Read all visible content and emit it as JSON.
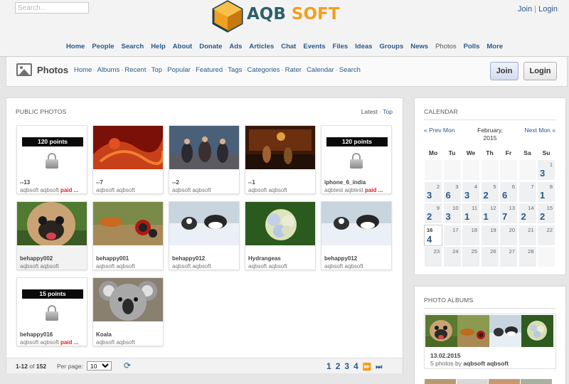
{
  "header": {
    "search_placeholder": "Search...",
    "logo": {
      "part1": "AQB",
      "part2": "SOFT"
    },
    "join_link": "Join",
    "separator": "|",
    "login_link": "Login"
  },
  "nav": [
    "Home",
    "People",
    "Search",
    "Help",
    "About",
    "Donate",
    "Ads",
    "Articles",
    "Chat",
    "Events",
    "Files",
    "Ideas",
    "Groups",
    "News",
    "Photos",
    "Polls",
    "More"
  ],
  "nav_current": "Photos",
  "section": {
    "title": "Photos",
    "subnav": [
      "Home",
      "Albums",
      "Recent",
      "Top",
      "Popular",
      "Featured",
      "Tags",
      "Categories",
      "Rater",
      "Calendar",
      "Search"
    ],
    "subnav_sep": "·",
    "join_button": "Join",
    "login_button": "Login"
  },
  "photos_panel": {
    "title": "PUBLIC PHOTOS",
    "tab_current": "Latest",
    "tab_sep": "·",
    "tab_other": "Top",
    "cards": [
      {
        "caption": "--13",
        "author": "aqbsoft aqbsoft",
        "paid": "paid ...",
        "points": "120 points",
        "type": "locked"
      },
      {
        "caption": "--7",
        "author": "aqbsoft aqbsoft",
        "type": "photo",
        "scene": "red"
      },
      {
        "caption": "--2",
        "author": "aqbsoft aqbsoft",
        "type": "photo",
        "scene": "band"
      },
      {
        "caption": "--1",
        "author": "aqbsoft aqbsoft",
        "type": "photo",
        "scene": "stage"
      },
      {
        "caption": "iphone_6_india",
        "author": "aqbtest aqbtest",
        "paid": "paid ...",
        "points": "120 points",
        "type": "locked"
      },
      {
        "caption": "behappy002",
        "author": "aqbsoft aqbsoft",
        "type": "photo",
        "scene": "pug"
      },
      {
        "caption": "behappy001",
        "author": "aqbsoft aqbsoft",
        "type": "photo",
        "scene": "moto"
      },
      {
        "caption": "behappy012",
        "author": "aqbsoft aqbsoft",
        "type": "photo",
        "scene": "snow"
      },
      {
        "caption": "Hydrangeas",
        "author": "aqbsoft aqbsoft",
        "type": "photo",
        "scene": "flower"
      },
      {
        "caption": "behappy012",
        "author": "aqbsoft aqbsoft",
        "type": "photo",
        "scene": "snow"
      },
      {
        "caption": "behappy016",
        "author": "aqbsoft aqbsoft",
        "paid": "paid ...",
        "points": "15 points",
        "type": "locked"
      },
      {
        "caption": "Koala",
        "author": "aqbsoft aqbsoft",
        "type": "photo",
        "scene": "koala"
      }
    ],
    "pager": {
      "range": "1-12",
      "of": "of",
      "total": "152",
      "per_page_label": "Per page:",
      "per_page_value": "10",
      "pages": [
        "1",
        "2",
        "3",
        "4"
      ],
      "next_icon": "fast-forward-icon",
      "last_icon": "skip-to-end-icon"
    }
  },
  "calendar": {
    "title": "CALENDAR",
    "prev": "« Prev Mon",
    "month_line1": "February,",
    "month_line2": "2015",
    "next": "Next Mon »",
    "days": [
      "Mo",
      "Tu",
      "We",
      "Th",
      "Fr",
      "Sa",
      "Su"
    ],
    "cells": [
      {
        "d": "",
        "c": ""
      },
      {
        "d": "",
        "c": ""
      },
      {
        "d": "",
        "c": ""
      },
      {
        "d": "",
        "c": ""
      },
      {
        "d": "",
        "c": ""
      },
      {
        "d": "",
        "c": ""
      },
      {
        "d": "1",
        "c": "3"
      },
      {
        "d": "2",
        "c": "3"
      },
      {
        "d": "3",
        "c": "6"
      },
      {
        "d": "4",
        "c": "3"
      },
      {
        "d": "5",
        "c": "2"
      },
      {
        "d": "6",
        "c": "6"
      },
      {
        "d": "7",
        "c": ""
      },
      {
        "d": "8",
        "c": "1"
      },
      {
        "d": "9",
        "c": "2"
      },
      {
        "d": "10",
        "c": "3"
      },
      {
        "d": "11",
        "c": "1"
      },
      {
        "d": "12",
        "c": "1"
      },
      {
        "d": "13",
        "c": "7"
      },
      {
        "d": "14",
        "c": "2"
      },
      {
        "d": "15",
        "c": "2"
      },
      {
        "d": "16",
        "c": "4",
        "today": true
      },
      {
        "d": "17",
        "c": ""
      },
      {
        "d": "18",
        "c": ""
      },
      {
        "d": "19",
        "c": ""
      },
      {
        "d": "20",
        "c": ""
      },
      {
        "d": "21",
        "c": ""
      },
      {
        "d": "22",
        "c": ""
      },
      {
        "d": "23",
        "c": ""
      },
      {
        "d": "24",
        "c": ""
      },
      {
        "d": "25",
        "c": ""
      },
      {
        "d": "26",
        "c": ""
      },
      {
        "d": "27",
        "c": ""
      },
      {
        "d": "28",
        "c": ""
      },
      {
        "d": "",
        "c": ""
      }
    ]
  },
  "albums": {
    "title": "PHOTO ALBUMS",
    "date": "13.02.2015",
    "desc_prefix": "5 photos by",
    "desc_author": "aqbsoft aqbsoft"
  },
  "colors": {
    "link": "#2a5a8a",
    "paid": "#e02222",
    "logo_dark": "#2d5f6a",
    "logo_orange": "#f0a020"
  }
}
